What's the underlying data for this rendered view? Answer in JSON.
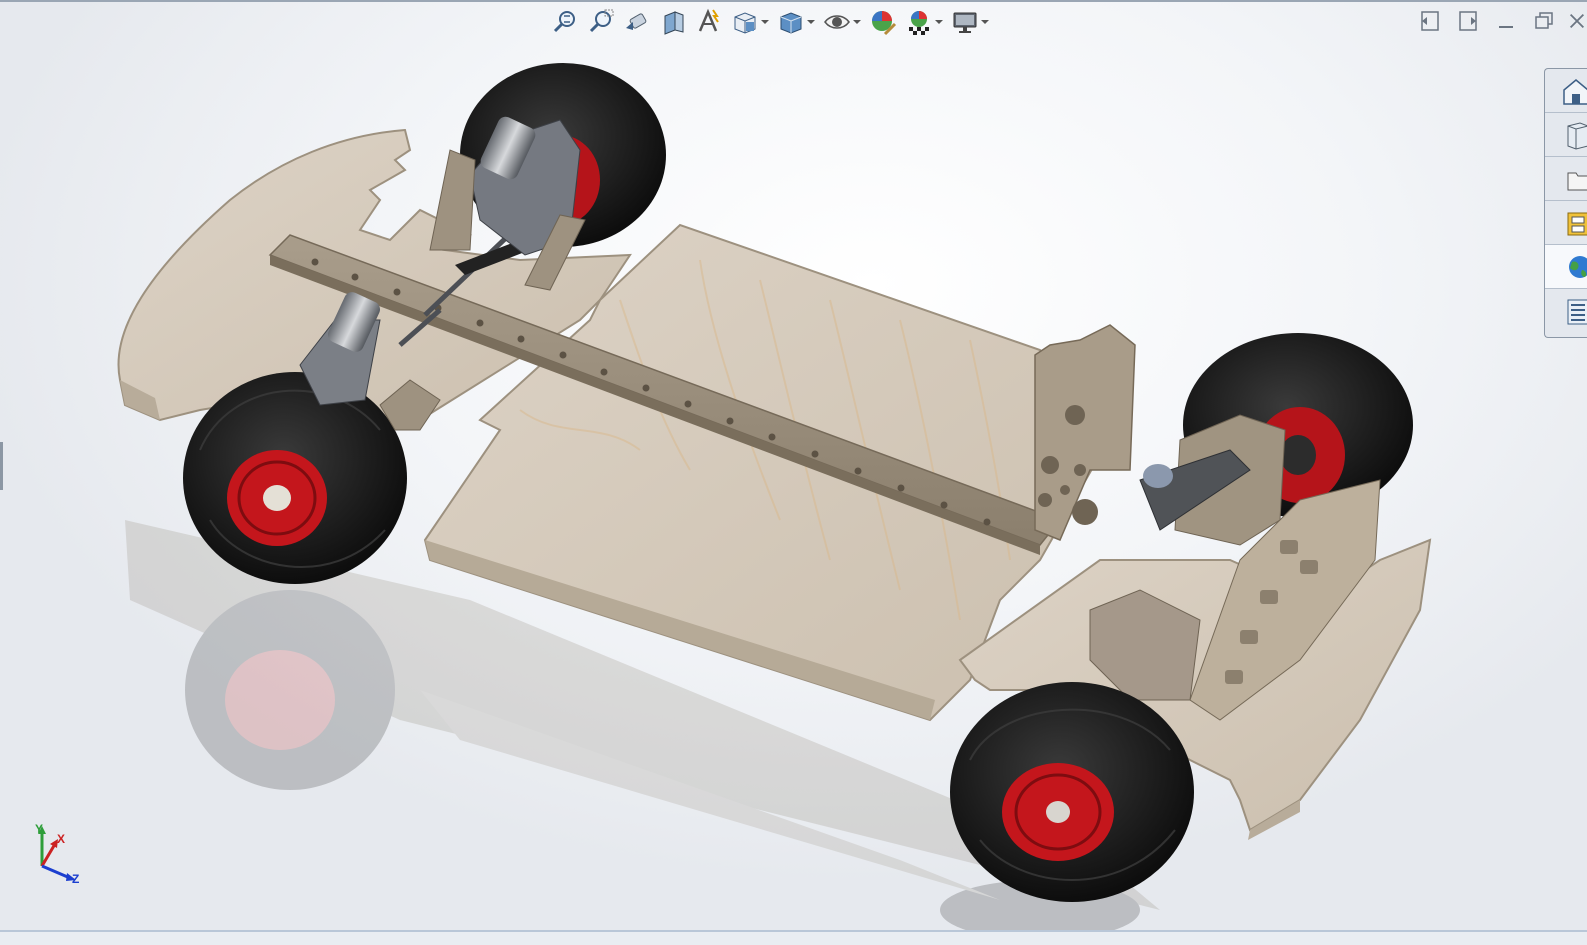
{
  "window": {
    "controls": [
      {
        "name": "tile-left",
        "icon": "tile-left-icon"
      },
      {
        "name": "tile-right",
        "icon": "tile-right-icon"
      },
      {
        "name": "minimize",
        "icon": "minimize-icon"
      },
      {
        "name": "restore",
        "icon": "restore-icon"
      },
      {
        "name": "close",
        "icon": "close-icon"
      }
    ]
  },
  "toolbar": {
    "tools": [
      {
        "name": "zoom-to-fit",
        "icon": "zoom-to-fit-icon"
      },
      {
        "name": "zoom-to-area",
        "icon": "zoom-to-area-icon"
      },
      {
        "name": "previous-view",
        "icon": "previous-view-icon"
      },
      {
        "name": "section-view",
        "icon": "section-view-icon"
      },
      {
        "name": "dynamic-annotation-views",
        "icon": "dynamic-annotation-icon"
      },
      {
        "name": "view-orientation",
        "icon": "view-orientation-icon",
        "dropdown": true
      },
      {
        "name": "display-style",
        "icon": "display-style-icon",
        "dropdown": true
      },
      {
        "name": "hide-show-items",
        "icon": "hide-show-icon",
        "dropdown": true
      },
      {
        "name": "edit-appearance",
        "icon": "edit-appearance-icon"
      },
      {
        "name": "apply-scene",
        "icon": "apply-scene-icon",
        "dropdown": true
      },
      {
        "name": "view-settings",
        "icon": "monitor-icon",
        "dropdown": true
      }
    ]
  },
  "task_pane": {
    "tabs": [
      {
        "name": "solidworks-resources",
        "icon": "home-icon"
      },
      {
        "name": "design-library",
        "icon": "design-library-icon"
      },
      {
        "name": "file-explorer",
        "icon": "folder-icon"
      },
      {
        "name": "view-palette",
        "icon": "view-palette-icon"
      },
      {
        "name": "appearances-scenes-decals",
        "icon": "globe-icon"
      },
      {
        "name": "custom-properties",
        "icon": "custom-properties-icon"
      }
    ]
  },
  "triad": {
    "x_label": "X",
    "y_label": "Y",
    "z_label": "Z"
  },
  "colors": {
    "wood": "#d6cbbd",
    "wood_dark": "#a89a88",
    "tire": "#1b1b1b",
    "rim": "#c4161c",
    "metal": "#8e9298"
  }
}
